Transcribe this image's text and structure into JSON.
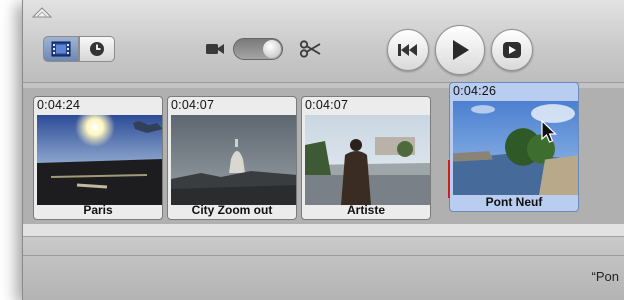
{
  "toolbar": {
    "view_buttons": [
      "filmstrip-icon",
      "clock-icon"
    ],
    "mode_switch": {
      "left_icon": "camera-icon",
      "right_icon": "scissors-icon"
    },
    "transport": [
      "rewind-icon",
      "play-icon",
      "fullscreen-play-icon"
    ]
  },
  "clips": [
    {
      "duration": "0:04:24",
      "title": "Paris",
      "selected": false
    },
    {
      "duration": "0:04:07",
      "title": "City Zoom out",
      "selected": false
    },
    {
      "duration": "0:04:07",
      "title": "Artiste",
      "selected": false
    },
    {
      "duration": "0:04:26",
      "title": "Pont Neuf",
      "selected": true
    }
  ],
  "status": {
    "text": "“Pon"
  },
  "colors": {
    "selected_clip": "#b8cdef",
    "playhead": "#d21b1b",
    "window": "#c4c4c4"
  }
}
